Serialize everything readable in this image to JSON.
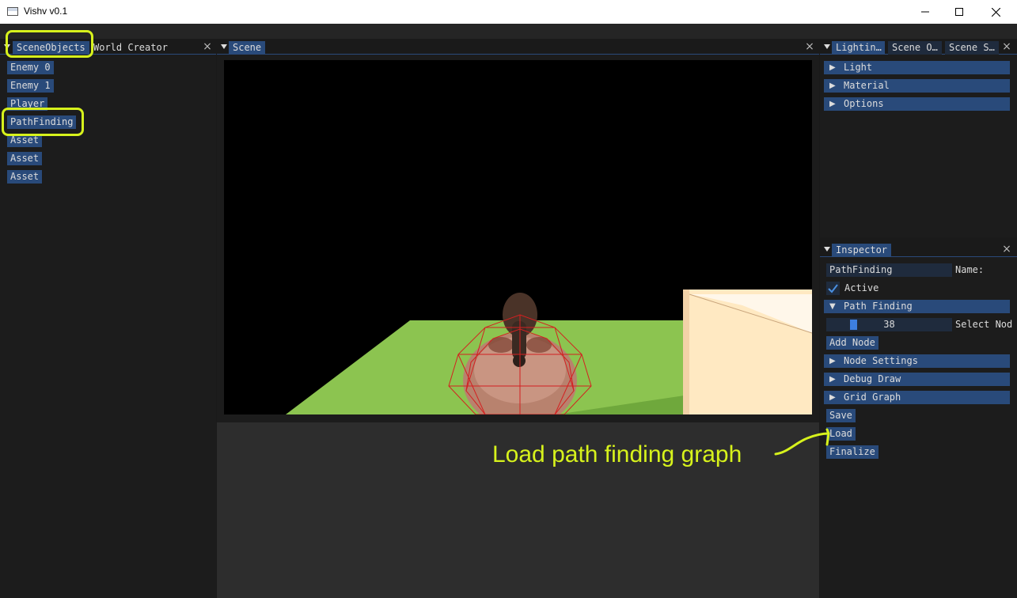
{
  "window": {
    "title": "Vishv v0.1",
    "minimize": "—",
    "maximize": "☐",
    "close": "✕"
  },
  "scene_objects_panel": {
    "tabs": [
      "SceneObjects",
      "World Creator"
    ],
    "items": [
      "Enemy 0",
      "Enemy 1",
      "Player",
      "PathFinding",
      "Asset",
      "Asset",
      "Asset"
    ]
  },
  "scene_panel": {
    "tab": "Scene"
  },
  "right_top_panel": {
    "tabs": [
      "Lightin…",
      "Scene O…",
      "Scene S…"
    ],
    "sections": [
      "Light",
      "Material",
      "Options"
    ]
  },
  "inspector": {
    "tab": "Inspector",
    "name_value": "PathFinding",
    "name_label": "Name:",
    "active_label": "Active",
    "active_checked": true,
    "path_finding_header": "Path Finding",
    "select_node_value": "38",
    "select_node_label": "Select Nod",
    "add_node": "Add Node",
    "collapsed_sections": [
      "Node Settings",
      "Debug Draw",
      "Grid Graph"
    ],
    "save": "Save",
    "load": "Load",
    "finalize": "Finalize"
  },
  "annotation": {
    "text": "Load path finding graph",
    "color": "#d7f21c"
  },
  "colors": {
    "accent": "#294a7a",
    "ground": "#8cc450",
    "highlight": "#d7f21c"
  }
}
